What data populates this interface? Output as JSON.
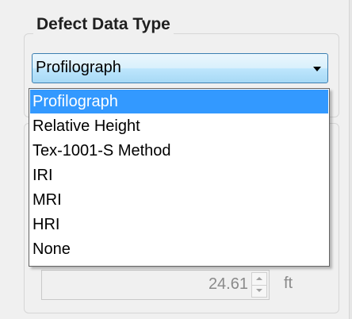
{
  "defect_data_type": {
    "title": "Defect Data Type",
    "selected": "Profilograph",
    "options": [
      "Profilograph",
      "Relative Height",
      "Tex-1001-S Method",
      "IRI",
      "MRI",
      "HRI",
      "None"
    ]
  },
  "spinner": {
    "value": "24.61",
    "unit": "ft"
  },
  "colors": {
    "highlight": "#3399ff",
    "combo_border": "#3c7fb1"
  },
  "icons": {
    "combo_arrow": "chevron-down-icon",
    "spin_up": "arrow-up-icon",
    "spin_down": "arrow-down-icon"
  }
}
